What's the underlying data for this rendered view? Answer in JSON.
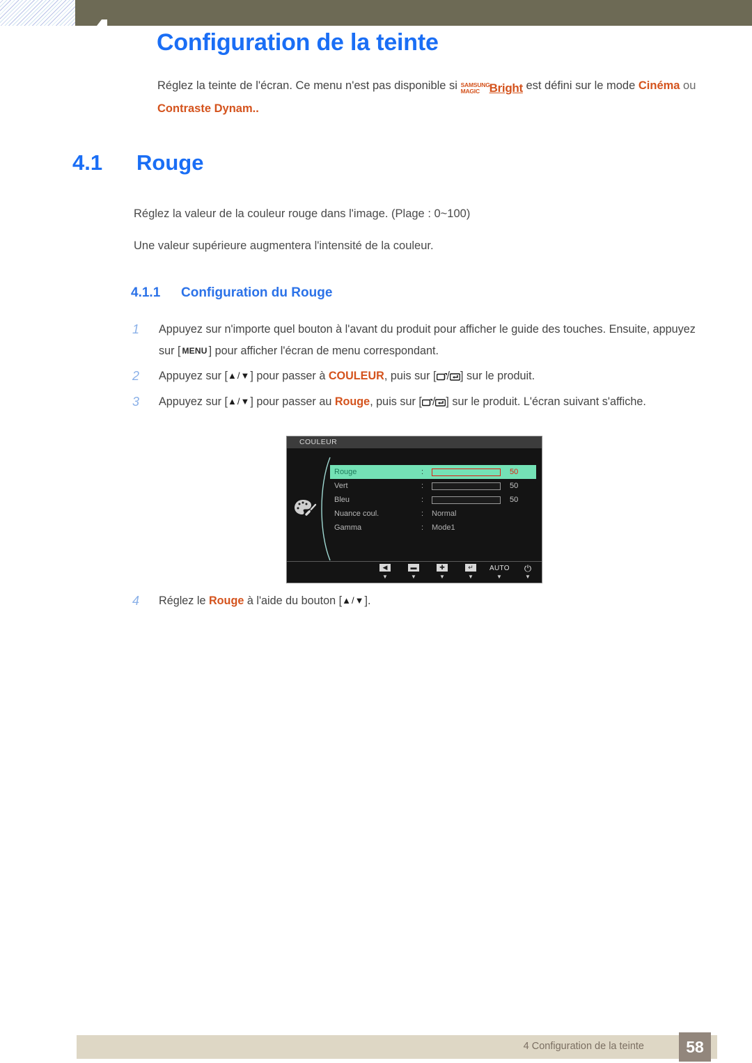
{
  "header": {
    "chapter_number": "4",
    "page_title": "Configuration de la teinte"
  },
  "intro": {
    "part1": "Réglez la teinte de l'écran. Ce menu n'est pas disponible si ",
    "logo_line1": "SAMSUNG",
    "logo_line2": "MAGIC",
    "logo_bright": "Bright",
    "part2": " est défini sur le mode ",
    "mode1": "Cinéma",
    "conjunction": " ou ",
    "mode2": "Contraste Dynam..",
    "accent_color": "#d4531d"
  },
  "section": {
    "number": "4.1",
    "title": "Rouge",
    "heading_color": "#1a6ef5"
  },
  "body": {
    "line1": "Réglez la valeur de la couleur rouge dans l'image. (Plage : 0~100)",
    "line2": "Une valeur supérieure augmentera l'intensité de la couleur."
  },
  "subsection": {
    "number": "4.1.1",
    "title": "Configuration du Rouge"
  },
  "steps": [
    {
      "num": "1",
      "text_a": "Appuyez sur n'importe quel bouton à l'avant du produit pour afficher le guide des touches. Ensuite, appuyez sur [",
      "key": "MENU",
      "text_b": "] pour afficher l'écran de menu correspondant."
    },
    {
      "num": "2",
      "text_a": "Appuyez sur [",
      "updown": "▲/▼",
      "text_b": "] pour passer à ",
      "highlight": "COULEUR",
      "text_c": ", puis sur [",
      "text_d": "] sur le produit."
    },
    {
      "num": "3",
      "text_a": "Appuyez sur [",
      "updown": "▲/▼",
      "text_b": "] pour passer au ",
      "highlight": "Rouge",
      "text_c": ", puis sur [",
      "text_d": "] sur le produit. L'écran suivant s'affiche."
    }
  ],
  "step4": {
    "num": "4",
    "text_a": "Réglez le ",
    "highlight": "Rouge",
    "text_b": " à l'aide du bouton [",
    "updown": "▲/▼",
    "text_c": "]."
  },
  "osd": {
    "title": "COULEUR",
    "icon_name": "palette-icon",
    "rows": [
      {
        "label": "Rouge",
        "colon": ":",
        "type": "bar",
        "value": "50",
        "percent": 50,
        "selected": true
      },
      {
        "label": "Vert",
        "colon": ":",
        "type": "bar",
        "value": "50",
        "percent": 50,
        "selected": false
      },
      {
        "label": "Bleu",
        "colon": ":",
        "type": "bar",
        "value": "50",
        "percent": 50,
        "selected": false
      },
      {
        "label": "Nuance coul.",
        "colon": ":",
        "type": "text",
        "value": "Normal",
        "selected": false
      },
      {
        "label": "Gamma",
        "colon": ":",
        "type": "text",
        "value": "Mode1",
        "selected": false
      }
    ],
    "buttons": [
      {
        "name": "back-button",
        "glyph": "◀",
        "kind": "box"
      },
      {
        "name": "minus-button",
        "glyph": "▬",
        "kind": "box"
      },
      {
        "name": "plus-button",
        "glyph": "✚",
        "kind": "box"
      },
      {
        "name": "enter-button",
        "glyph": "↵",
        "kind": "box"
      },
      {
        "name": "auto-button",
        "glyph": "AUTO",
        "kind": "text"
      },
      {
        "name": "power-button",
        "glyph": "⏻",
        "kind": "power"
      }
    ],
    "highlight_bg": "#74e2b6",
    "bar_fill_selected": "#ef0d0d",
    "bar_fill_normal": "#9d9d9d"
  },
  "footer": {
    "text": "4 Configuration de la teinte",
    "page_number": "58"
  }
}
